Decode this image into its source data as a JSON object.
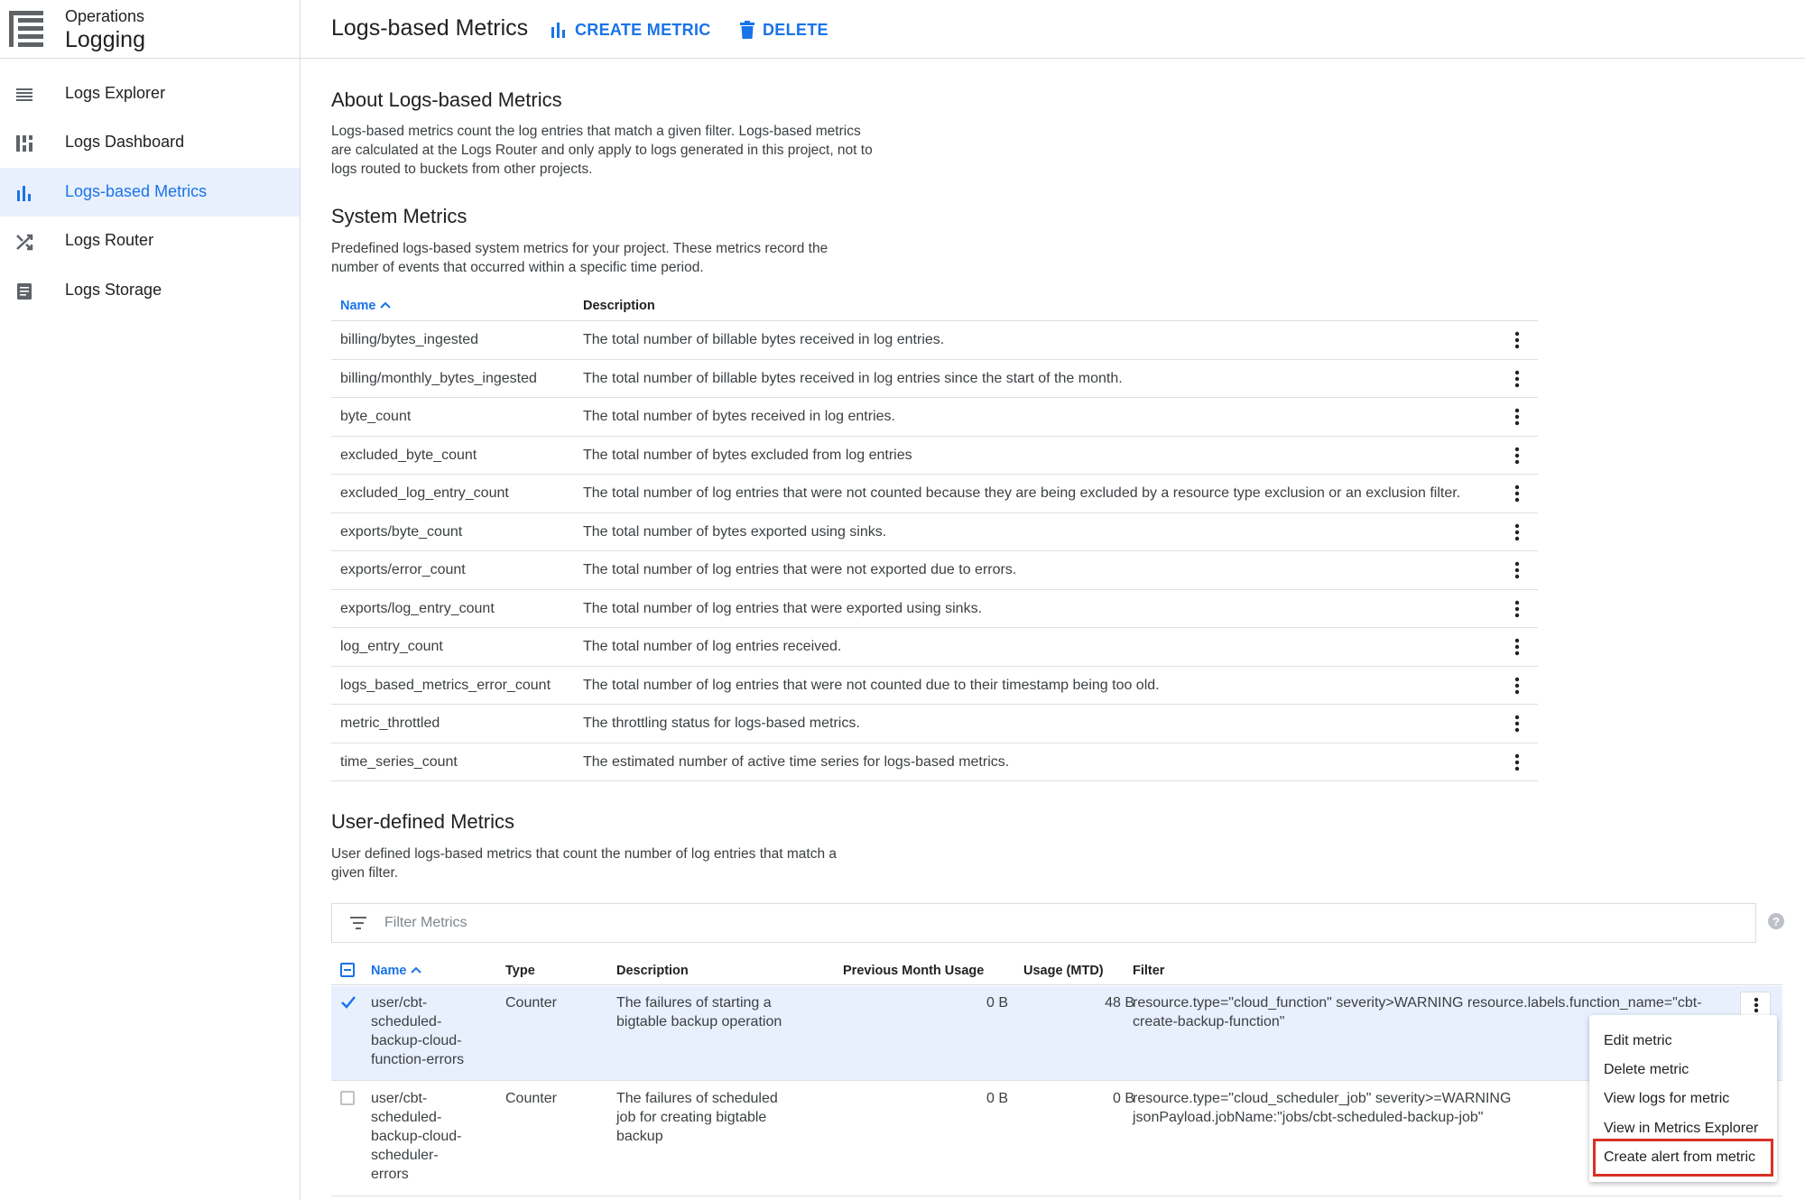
{
  "app": {
    "suptitle": "Operations",
    "title": "Logging"
  },
  "sidebar": {
    "items": [
      {
        "label": "Logs Explorer",
        "icon": "list-icon",
        "active": false
      },
      {
        "label": "Logs Dashboard",
        "icon": "dashboard-icon",
        "active": false
      },
      {
        "label": "Logs-based Metrics",
        "icon": "bar-chart-icon",
        "active": true
      },
      {
        "label": "Logs Router",
        "icon": "shuffle-icon",
        "active": false
      },
      {
        "label": "Logs Storage",
        "icon": "storage-icon",
        "active": false
      }
    ]
  },
  "header": {
    "title": "Logs-based Metrics",
    "create_label": "CREATE METRIC",
    "delete_label": "DELETE"
  },
  "about": {
    "title": "About Logs-based Metrics",
    "text": "Logs-based metrics count the log entries that match a given filter. Logs-based metrics are calculated at the Logs Router and only apply to logs generated in this project, not to logs routed to buckets from other projects."
  },
  "system": {
    "title": "System Metrics",
    "text": "Predefined logs-based system metrics for your project. These metrics record the number of events that occurred within a specific time period.",
    "columns": {
      "name": "Name",
      "description": "Description"
    },
    "rows": [
      {
        "name": "billing/bytes_ingested",
        "description": "The total number of billable bytes received in log entries."
      },
      {
        "name": "billing/monthly_bytes_ingested",
        "description": "The total number of billable bytes received in log entries since the start of the month."
      },
      {
        "name": "byte_count",
        "description": "The total number of bytes received in log entries."
      },
      {
        "name": "excluded_byte_count",
        "description": "The total number of bytes excluded from log entries"
      },
      {
        "name": "excluded_log_entry_count",
        "description": "The total number of log entries that were not counted because they are being excluded by a resource type exclusion or an exclusion filter."
      },
      {
        "name": "exports/byte_count",
        "description": "The total number of bytes exported using sinks."
      },
      {
        "name": "exports/error_count",
        "description": "The total number of log entries that were not exported due to errors."
      },
      {
        "name": "exports/log_entry_count",
        "description": "The total number of log entries that were exported using sinks."
      },
      {
        "name": "log_entry_count",
        "description": "The total number of log entries received."
      },
      {
        "name": "logs_based_metrics_error_count",
        "description": "The total number of log entries that were not counted due to their timestamp being too old."
      },
      {
        "name": "metric_throttled",
        "description": "The throttling status for logs-based metrics."
      },
      {
        "name": "time_series_count",
        "description": "The estimated number of active time series for logs-based metrics."
      }
    ]
  },
  "user_defined": {
    "title": "User-defined Metrics",
    "text": "User defined logs-based metrics that count the number of log entries that match a given filter.",
    "filter_placeholder": "Filter Metrics",
    "columns": {
      "name": "Name",
      "type": "Type",
      "description": "Description",
      "prev_usage": "Previous Month Usage",
      "usage": "Usage (MTD)",
      "filter": "Filter"
    },
    "rows": [
      {
        "name": "user/cbt-\nscheduled-\nbackup-cloud-\nfunction-errors",
        "type": "Counter",
        "description": "The failures of starting a\nbigtable backup operation",
        "prev_usage": "0 B",
        "usage": "48 B",
        "filter": "resource.type=\"cloud_function\" severity>WARNING resource.labels.function_name=\"cbt-\ncreate-backup-function\"",
        "checked": true
      },
      {
        "name": "user/cbt-\nscheduled-\nbackup-cloud-\nscheduler-\nerrors",
        "type": "Counter",
        "description": "The failures of scheduled\njob for creating bigtable\nbackup",
        "prev_usage": "0 B",
        "usage": "0 B",
        "filter": "resource.type=\"cloud_scheduler_job\" severity>=WARNING\njsonPayload.jobName:\"jobs/cbt-scheduled-backup-job\"",
        "checked": false
      }
    ]
  },
  "menu": {
    "items": [
      "Edit metric",
      "Delete metric",
      "View logs for metric",
      "View in Metrics Explorer",
      "Create alert from metric"
    ],
    "highlighted": "Create alert from metric"
  },
  "colors": {
    "accent": "#1a73e8",
    "highlight": "#d93025",
    "active_bg": "#e8f0fe"
  }
}
